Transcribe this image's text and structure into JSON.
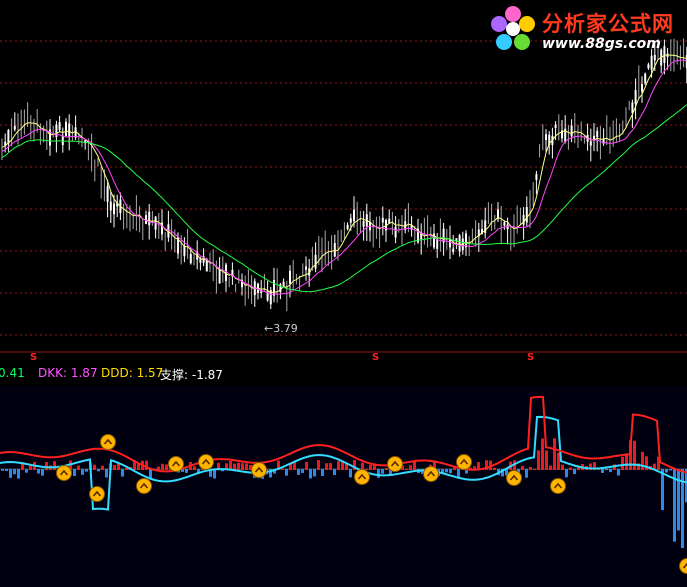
{
  "watermark": {
    "title": "分析家公式网",
    "url": "www.88gs.com",
    "logo": "flower-logo"
  },
  "main_chart": {
    "low_marker": "3.79",
    "signal_marker": "S"
  },
  "indicator": {
    "values": [
      {
        "label": "D:",
        "value": "0.41",
        "color": "#00ff66"
      },
      {
        "label": "DKK:",
        "value": "1.87",
        "color": "#ff55ff"
      },
      {
        "label": "DDD:",
        "value": "1.57",
        "color": "#ffdd00"
      },
      {
        "label": "支撑:",
        "value": "-1.87",
        "color": "#ffffff"
      }
    ]
  },
  "colors": {
    "background": "#000000",
    "up_candle": "#ffffff",
    "ma_short": "#ffff88",
    "ma_mid": "#ff44ff",
    "ma_long": "#22ff44",
    "gridline": "#8a1a1a",
    "bar_up": "#ff2020",
    "bar_down": "#3399ff",
    "line_cyan": "#33ddff",
    "marker_gold": "#ffb400"
  }
}
